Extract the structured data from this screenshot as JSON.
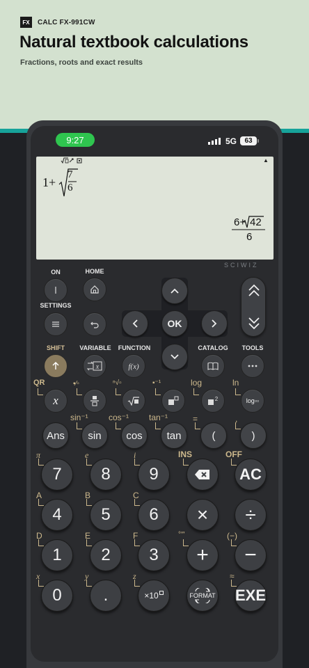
{
  "brand": {
    "logo": "FX",
    "name": "CALC FX-991CW"
  },
  "headline": "Natural textbook calculations",
  "subline": "Fractions, roots and exact results",
  "status": {
    "time": "9:27",
    "network": "5G",
    "battery": "63"
  },
  "display": {
    "expr_prefix": "1+",
    "expr_num": "7",
    "expr_den": "6",
    "result_num": "6+√42",
    "result_num_prefix": "6+",
    "result_num_radicand": "42",
    "result_den": "6"
  },
  "brand_strip": "SCIWIZ",
  "top_labels": {
    "on": "ON",
    "home": "HOME",
    "settings": "SETTINGS",
    "shift": "SHIFT",
    "variable": "VARIABLE",
    "function": "FUNCTION",
    "catalog": "CATALOG",
    "tools": "TOOLS"
  },
  "ok": "OK",
  "row_fx": {
    "x_shift": "QR",
    "sqrt_shift": "ln",
    "log_shift": "log",
    "x_label": "x",
    "log_label": "log▫▫"
  },
  "row_trig": {
    "ans": "Ans",
    "sin": "sin",
    "cos": "cos",
    "tan": "tan",
    "lparen": "(",
    "rparen": ")",
    "sin_shift": "sin⁻¹",
    "cos_shift": "cos⁻¹",
    "tan_shift": "tan⁻¹",
    "lparen_shift": "=",
    "rparen_shift": ","
  },
  "keys": {
    "k7": "7",
    "k8": "8",
    "k9": "9",
    "del_shift": "INS",
    "ac": "AC",
    "ac_shift": "OFF",
    "k4": "4",
    "k5": "5",
    "k6": "6",
    "mul": "×",
    "div": "÷",
    "k1": "1",
    "k2": "2",
    "k3": "3",
    "plus": "+",
    "minus": "−",
    "k0": "0",
    "dot": ".",
    "exp": "×10",
    "exp_sup": "x",
    "format": "FORMAT",
    "exe": "EXE",
    "s7": "π",
    "s8": "e",
    "s9": "i",
    "s4": "A",
    "s5": "B",
    "s6": "C",
    "s1": "D",
    "s2": "E",
    "s3": "F",
    "splus": "°′″",
    "sminus": "(−)",
    "s0": "x",
    "sdot": "y",
    "sexp": "z",
    "sexe": "≈"
  },
  "colors": {
    "banner": "#d3e1cf",
    "accent": "#17a39a",
    "shift": "#8a7b5e",
    "gold": "#cdb98d",
    "lcd": "#dfe4d9"
  }
}
